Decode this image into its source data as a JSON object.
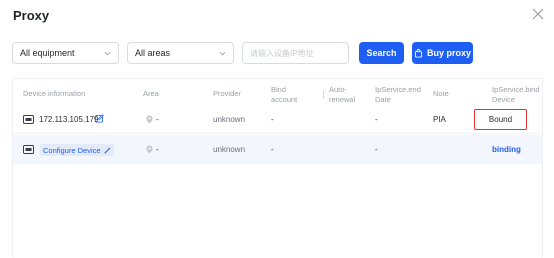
{
  "dialog": {
    "title": "Proxy",
    "close_icon": "close-icon"
  },
  "filters": {
    "equipment": {
      "value": "All equipment"
    },
    "areas": {
      "value": "All areas"
    },
    "search": {
      "placeholder": "请输入设备IP地址"
    },
    "search_label": "Search",
    "buy_label": "Buy proxy"
  },
  "table": {
    "headers": {
      "device": "Device information",
      "area": "Area",
      "provider": "Provider",
      "bind_account_1": "Bind",
      "bind_account_2": "account",
      "auto_renewal_1": "Auto-",
      "auto_renewal_2": "renewal",
      "ip_end_1": "IpService.end",
      "ip_end_2": "Date",
      "note": "Note",
      "ip_bind_1": "IpService.bind",
      "ip_bind_2": "Device"
    },
    "rows": [
      {
        "device": "172.113.105.179",
        "area": "-",
        "provider": "unknown",
        "bind_account": "-",
        "end_date": "-",
        "note": "PIA",
        "bind_device": "Bound"
      },
      {
        "device": "Configure Device",
        "area": "-",
        "provider": "unknown",
        "bind_account": "-",
        "end_date": "-",
        "note": "",
        "bind_device": "binding"
      }
    ]
  },
  "colors": {
    "primary": "#1f5ef2",
    "highlight": "#e0343a",
    "row_alt": "#f3f6fc"
  }
}
